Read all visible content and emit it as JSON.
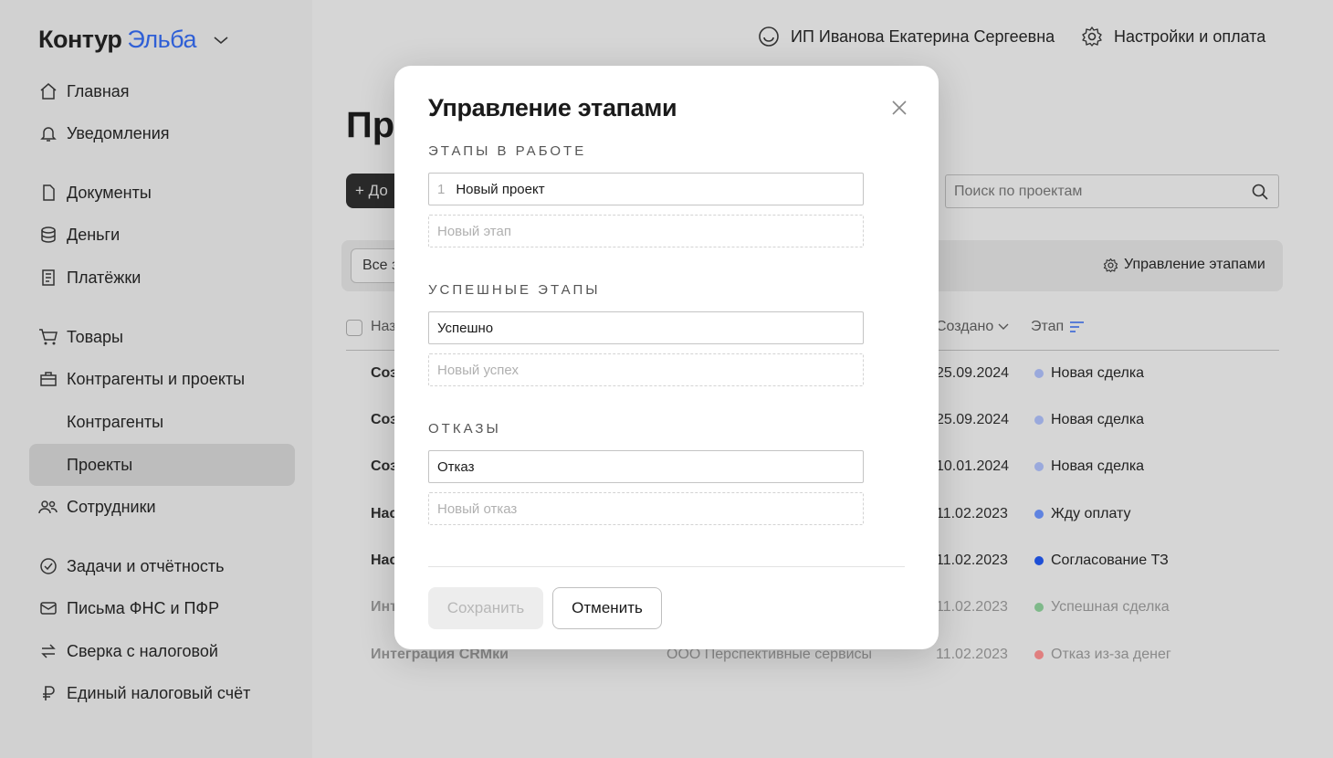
{
  "app": {
    "logo_part1": "Контур",
    "logo_part2": "Эльба"
  },
  "header": {
    "org_name": "ИП Иванова Екатерина Сергеевна",
    "settings_label": "Настройки и оплата"
  },
  "sidebar": {
    "items": [
      {
        "label": "Главная",
        "icon": "home-icon"
      },
      {
        "label": "Уведомления",
        "icon": "bell-icon"
      },
      {
        "label": "Документы",
        "icon": "document-icon"
      },
      {
        "label": "Деньги",
        "icon": "coins-icon"
      },
      {
        "label": "Платёжки",
        "icon": "receipt-icon"
      },
      {
        "label": "Товары",
        "icon": "cart-icon"
      },
      {
        "label": "Контрагенты и проекты",
        "icon": "briefcase-icon"
      },
      {
        "label": "Контрагенты",
        "icon": ""
      },
      {
        "label": "Проекты",
        "icon": "",
        "active": true
      },
      {
        "label": "Сотрудники",
        "icon": "people-icon"
      },
      {
        "label": "Задачи и отчётность",
        "icon": "check-circle-icon"
      },
      {
        "label": "Письма ФНС и ПФР",
        "icon": "mail-icon"
      },
      {
        "label": "Сверка с налоговой",
        "icon": "swap-icon"
      },
      {
        "label": "Единый налоговый счёт",
        "icon": "ruble-icon"
      }
    ]
  },
  "main": {
    "title": "Пр",
    "add_button": "+ До",
    "search_placeholder": "Поиск по проектам",
    "filter_chip": "Все з",
    "stage_management": "Управление этапами",
    "columns": {
      "name": "Наз",
      "created": "Создано",
      "stage": "Этап"
    },
    "rows": [
      {
        "name": "Соз",
        "client": "",
        "created": "25.09.2024",
        "stage": "Новая сделка",
        "color": "#9aa9dc",
        "dim": false
      },
      {
        "name": "Соз",
        "client": "",
        "created": "25.09.2024",
        "stage": "Новая сделка",
        "color": "#9aa9dc",
        "dim": false
      },
      {
        "name": "Соз",
        "client": "",
        "created": "10.01.2024",
        "stage": "Новая сделка",
        "color": "#9aa9dc",
        "dim": false
      },
      {
        "name": "Нас",
        "client": "",
        "created": "11.02.2023",
        "stage": "Жду оплату",
        "color": "#5f83e0",
        "dim": false
      },
      {
        "name": "Нас",
        "client": "",
        "created": "11.02.2023",
        "stage": "Согласование ТЗ",
        "color": "#1e4fd6",
        "dim": false
      },
      {
        "name": "Инт",
        "client": "",
        "created": "11.02.2023",
        "stage": "Успешная сделка",
        "color": "#7fb98a",
        "dim": true
      },
      {
        "name": "Интеграция CRMки",
        "client": "ООО Перспективные сервисы",
        "created": "11.02.2023",
        "stage": "Отказ из-за денег",
        "color": "#e07f7f",
        "dim": true
      }
    ]
  },
  "modal": {
    "title": "Управление этапами",
    "in_progress_label": "Этапы в работе",
    "in_progress_items": [
      {
        "num": "1",
        "value": "Новый проект"
      }
    ],
    "in_progress_placeholder": "Новый этап",
    "success_label": "Успешные этапы",
    "success_value": "Успешно",
    "success_placeholder": "Новый успех",
    "reject_label": "Отказы",
    "reject_value": "Отказ",
    "reject_placeholder": "Новый отказ",
    "save_label": "Сохранить",
    "cancel_label": "Отменить"
  }
}
